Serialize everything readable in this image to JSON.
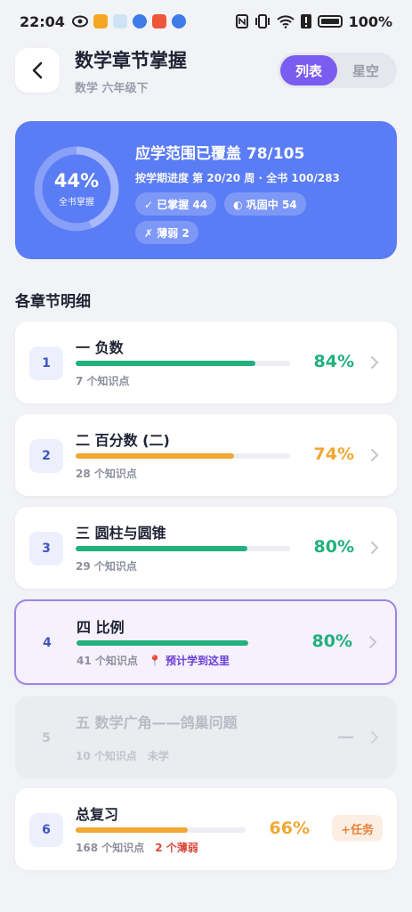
{
  "status_bar": {
    "time": "22:04",
    "battery": "100%"
  },
  "header": {
    "title": "数学章节掌握",
    "subtitle": "数学 六年级下",
    "tabs": [
      "列表",
      "星空"
    ],
    "active_tab": 0
  },
  "summary": {
    "mastery_pct": "44%",
    "mastery_value": 0.44,
    "mastery_label": "全书掌握",
    "title": "应学范围已覆盖 78/105",
    "progress_text": "按学期进度 第 20/20 周 · 全书 100/283",
    "chips": [
      "✓ 已掌握 44",
      "◐ 巩固中 54",
      "✗ 薄弱 2"
    ],
    "colors": {
      "card": "#5a7cf5"
    }
  },
  "section_title": "各章节明细",
  "chapters": [
    {
      "num": "1",
      "name": "一 负数",
      "points": "7 个知识点",
      "pct": "84%",
      "progress": 0.84,
      "color": "#22b07d"
    },
    {
      "num": "2",
      "name": "二 百分数 (二)",
      "points": "28 个知识点",
      "pct": "74%",
      "progress": 0.74,
      "color": "#f0a733"
    },
    {
      "num": "3",
      "name": "三 圆柱与圆锥",
      "points": "29 个知识点",
      "pct": "80%",
      "progress": 0.8,
      "color": "#22b07d"
    },
    {
      "num": "4",
      "name": "四 比例",
      "points": "41 个知识点",
      "plan": "📍 预计学到这里",
      "pct": "80%",
      "progress": 0.8,
      "color": "#22b07d"
    },
    {
      "num": "5",
      "name": "五 数学广角——鸽巢问题",
      "points": "10 个知识点",
      "status": "未学",
      "pct": "—",
      "progress": 0
    },
    {
      "num": "6",
      "name": "总复习",
      "points": "168 个知识点",
      "weak": "2 个薄弱",
      "pct": "66%",
      "progress": 0.66,
      "color": "#f0a733",
      "task": "+任务"
    }
  ]
}
